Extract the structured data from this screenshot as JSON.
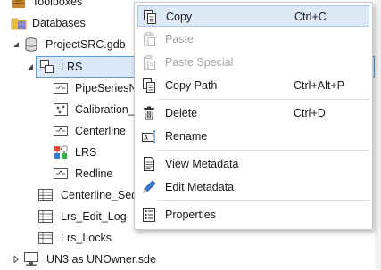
{
  "tree": {
    "toolboxes": "Toolboxes",
    "databases": "Databases",
    "gdb": "ProjectSRC.gdb",
    "lrs": "LRS",
    "pipeseries": "PipeSeriesNetwork",
    "calibration": "Calibration_Point",
    "centerline": "Centerline",
    "lrs_child": "LRS",
    "redline": "Redline",
    "centerline_seq": "Centerline_Sequence",
    "edit_log": "Lrs_Edit_Log",
    "locks": "Lrs_Locks",
    "un3": "UN3 as UNOwner.sde"
  },
  "menu": {
    "copy": {
      "label": "Copy",
      "shortcut": "Ctrl+C",
      "icon": "copy-icon"
    },
    "paste": {
      "label": "Paste",
      "icon": "paste-icon"
    },
    "paste_special": {
      "label": "Paste Special",
      "icon": "paste-special-icon"
    },
    "copy_path": {
      "label": "Copy Path",
      "shortcut": "Ctrl+Alt+P",
      "icon": "copy-path-icon"
    },
    "delete": {
      "label": "Delete",
      "shortcut": "Ctrl+D",
      "icon": "delete-icon"
    },
    "rename": {
      "label": "Rename",
      "icon": "rename-icon"
    },
    "view_metadata": {
      "label": "View Metadata",
      "icon": "view-metadata-icon"
    },
    "edit_metadata": {
      "label": "Edit Metadata",
      "icon": "edit-metadata-icon"
    },
    "properties": {
      "label": "Properties",
      "icon": "properties-icon"
    }
  }
}
